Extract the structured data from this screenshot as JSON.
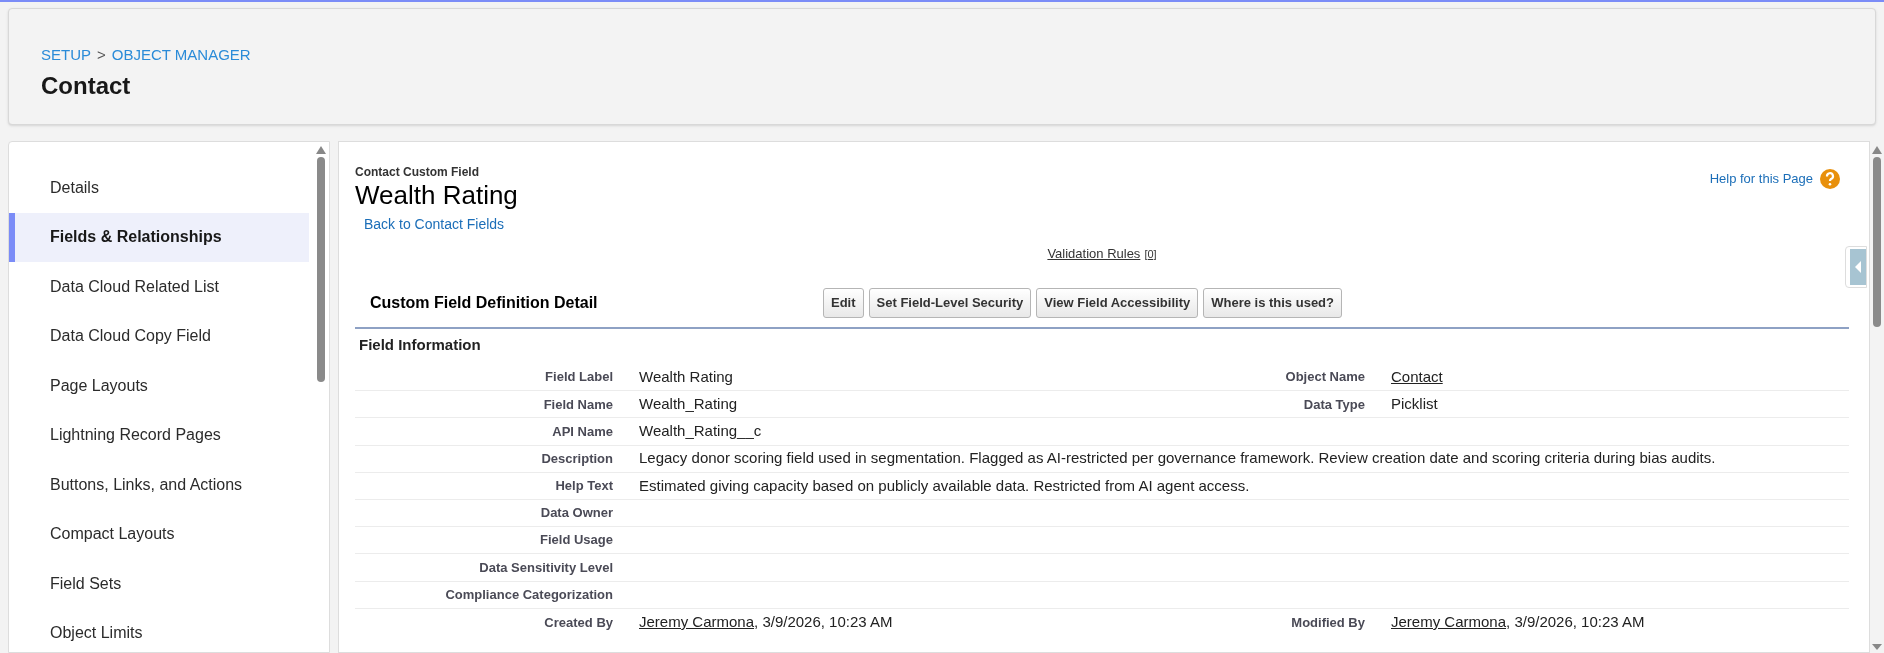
{
  "breadcrumb": [
    {
      "label": "SETUP"
    },
    {
      "label": "OBJECT MANAGER"
    }
  ],
  "breadcrumb_separator": ">",
  "page_title": "Contact",
  "sidebar": {
    "items": [
      {
        "label": "Details",
        "selected": false
      },
      {
        "label": "Fields & Relationships",
        "selected": true
      },
      {
        "label": "Data Cloud Related List",
        "selected": false
      },
      {
        "label": "Data Cloud Copy Field",
        "selected": false
      },
      {
        "label": "Page Layouts",
        "selected": false
      },
      {
        "label": "Lightning Record Pages",
        "selected": false
      },
      {
        "label": "Buttons, Links, and Actions",
        "selected": false
      },
      {
        "label": "Compact Layouts",
        "selected": false
      },
      {
        "label": "Field Sets",
        "selected": false
      },
      {
        "label": "Object Limits",
        "selected": false
      }
    ]
  },
  "detail": {
    "subtitle": "Contact Custom Field",
    "title": "Wealth Rating",
    "back_link": "Back to Contact Fields",
    "help_link": "Help for this Page",
    "validation_rules": {
      "label": "Validation Rules",
      "count": "[0]"
    },
    "section_title": "Custom Field Definition Detail",
    "buttons": [
      "Edit",
      "Set Field-Level Security",
      "View Field Accessibility",
      "Where is this used?"
    ],
    "subsection_title": "Field Information",
    "rows": [
      {
        "left": {
          "label": "Field Label",
          "value": "Wealth Rating"
        },
        "right": {
          "label": "Object Name",
          "link": "Contact"
        }
      },
      {
        "left": {
          "label": "Field Name",
          "value": "Wealth_Rating"
        },
        "right": {
          "label": "Data Type",
          "value": "Picklist"
        }
      },
      {
        "left": {
          "label": "API Name",
          "value": "Wealth_Rating__c"
        }
      },
      {
        "left": {
          "label": "Description",
          "value": "Legacy donor scoring field used in segmentation. Flagged as AI-restricted per governance framework. Review creation date and scoring criteria during bias audits."
        }
      },
      {
        "left": {
          "label": "Help Text",
          "value": "Estimated giving capacity based on publicly available data. Restricted from AI agent access."
        }
      },
      {
        "left": {
          "label": "Data Owner"
        }
      },
      {
        "left": {
          "label": "Field Usage"
        }
      },
      {
        "left": {
          "label": "Data Sensitivity Level"
        }
      },
      {
        "left": {
          "label": "Compliance Categorization"
        }
      },
      {
        "left": {
          "label": "Created By",
          "link": "Jeremy Carmona",
          "value": ", 3/9/2026, 10:23 AM"
        },
        "right": {
          "label": "Modified By",
          "link": "Jeremy Carmona",
          "value": ", 3/9/2026, 10:23 AM"
        }
      }
    ]
  }
}
